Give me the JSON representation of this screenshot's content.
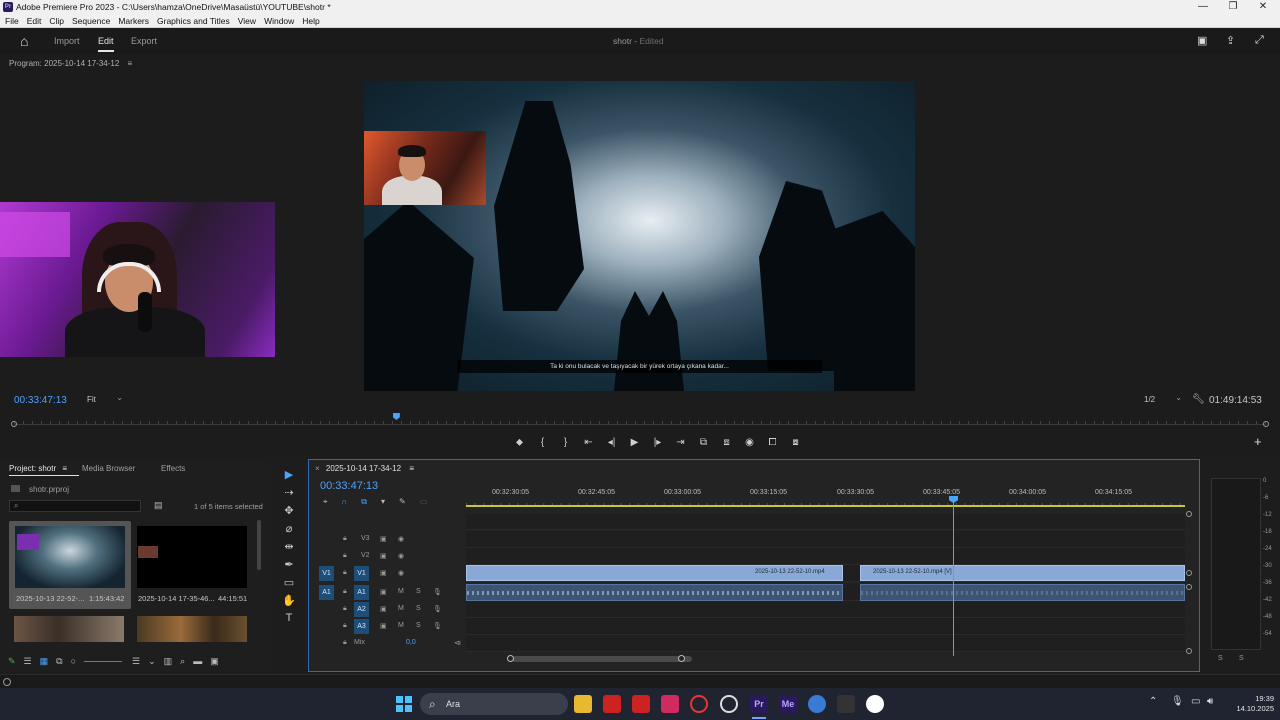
{
  "titlebar": {
    "title": "Adobe Premiere Pro 2023 - C:\\Users\\hamza\\OneDrive\\Masaüstü\\YOUTUBE\\shotr *",
    "app_icon": "Pr",
    "minimize": "—",
    "restore": "❐",
    "close": "✕"
  },
  "menu": [
    "File",
    "Edit",
    "Clip",
    "Sequence",
    "Markers",
    "Graphics and Titles",
    "View",
    "Window",
    "Help"
  ],
  "header": {
    "home_icon": "⌂",
    "nav": [
      "Import",
      "Edit",
      "Export"
    ],
    "active": "Edit",
    "project_name": "shotr",
    "separator": "-",
    "status": "Edited",
    "right_icons": [
      "▣",
      "⇪",
      "⤢"
    ]
  },
  "program": {
    "label": "Program: 2025-10-14 17-34-12",
    "menu_icon": "≡",
    "subtitle": "Ta ki onu bulacak ve taşıyacak bir yürek ortaya çıkana kadar...",
    "timecode": "00:33:47:13",
    "zoom": "Fit",
    "resolution": "1/2",
    "duration": "01:49:14:53",
    "playhead_fraction": 0.305,
    "transport": [
      "⬥",
      "{",
      "}",
      "⇤",
      "◂|",
      "▶",
      "|▸",
      "⇥",
      "⧉",
      "⧈",
      "◉",
      "⧠",
      "⧇"
    ],
    "add_button": "+"
  },
  "project": {
    "tabs": [
      "Project: shotr",
      "Media Browser",
      "Effects"
    ],
    "menu_icon": "≡",
    "file": "shotr.prproj",
    "search_icon": "⌕",
    "bin_icon": "▤",
    "count": "1 of 5 items selected",
    "items": [
      {
        "name": "2025-10-13 22-52-...",
        "duration": "1:15:43:42"
      },
      {
        "name": "2025-10-14 17-35-46...",
        "duration": "44:15:51"
      }
    ],
    "tools": [
      "✎",
      "☰",
      "▦",
      "⧉",
      "○",
      "☰",
      "⌄",
      "▥",
      "⌕",
      "▬",
      "▣"
    ]
  },
  "tools": [
    "▶",
    "⇢",
    "✥",
    "⌀",
    "⇹",
    "✒",
    "▭",
    "✋",
    "T"
  ],
  "timeline": {
    "sequence": "2025-10-14 17-34-12",
    "close_icon": "×",
    "menu_icon": "≡",
    "timecode": "00:33:47:13",
    "tool_icons": [
      "⌖",
      "∩",
      "⧉",
      "▾",
      "✎",
      "▭"
    ],
    "ruler": [
      "00:32:30:05",
      "00:32:45:05",
      "00:33:00:05",
      "00:33:15:05",
      "00:33:30:05",
      "00:33:45:05",
      "00:34:00:05",
      "00:34:15:05"
    ],
    "tracks": [
      {
        "src": "",
        "name": "V3",
        "lock": "🔒︎",
        "toggle": "▣",
        "eye": "◉"
      },
      {
        "src": "",
        "name": "V2",
        "lock": "🔒︎",
        "toggle": "▣",
        "eye": "◉"
      },
      {
        "src": "V1",
        "name": "V1",
        "lock": "🔒︎",
        "toggle": "▣",
        "eye": "◉"
      },
      {
        "src": "A1",
        "name": "A1",
        "lock": "🔒︎",
        "toggle": "▣",
        "m": "M",
        "s": "S",
        "mic": "🎙︎"
      },
      {
        "src": "",
        "name": "A2",
        "lock": "🔒︎",
        "toggle": "▣",
        "m": "M",
        "s": "S",
        "mic": "🎙︎"
      },
      {
        "src": "",
        "name": "A3",
        "lock": "🔒︎",
        "toggle": "▣",
        "m": "M",
        "s": "S",
        "mic": "🎙︎"
      }
    ],
    "mix": {
      "label": "Mix",
      "value": "0,0",
      "lock": "🔒︎",
      "end": "⧏"
    },
    "clips": [
      {
        "label": "2025-10-13 22-52-10.mp4"
      },
      {
        "label": "2025-10-13 22-52-10.mp4 [V]"
      }
    ]
  },
  "meter": {
    "scale": [
      "0",
      "-6",
      "-12",
      "-18",
      "-24",
      "-30",
      "-36",
      "-42",
      "-48",
      "-54"
    ],
    "solo": [
      "S",
      "S"
    ]
  },
  "taskbar": {
    "search": "Ara",
    "time": "19:39",
    "date": "14.10.2025",
    "tray": [
      "⌃",
      "🎙︎",
      "▭",
      "🔊︎"
    ],
    "icons": [
      {
        "name": "premiere",
        "text": "Pr",
        "color": "#2a1a5c"
      },
      {
        "name": "media-encoder",
        "text": "Me",
        "color": "#2a1a5c"
      }
    ]
  }
}
